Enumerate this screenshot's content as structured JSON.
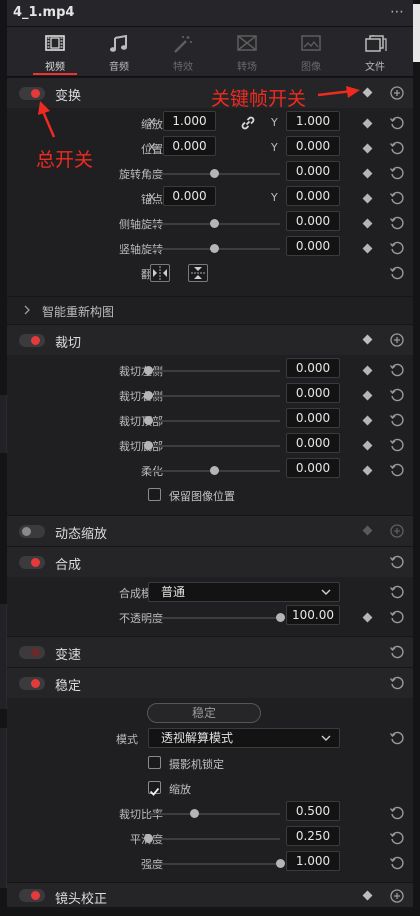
{
  "file": {
    "name": "4_1.mp4",
    "menu_glyph": "⋯"
  },
  "tabs": [
    {
      "label": "视频",
      "icon": "film-icon",
      "active": true,
      "enabled": true
    },
    {
      "label": "音频",
      "icon": "music-note-icon",
      "active": false,
      "enabled": true
    },
    {
      "label": "特效",
      "icon": "magic-wand-icon",
      "active": false,
      "enabled": false
    },
    {
      "label": "转场",
      "icon": "transition-icon",
      "active": false,
      "enabled": false
    },
    {
      "label": "图像",
      "icon": "image-icon",
      "active": false,
      "enabled": false
    },
    {
      "label": "文件",
      "icon": "file-stack-icon",
      "active": false,
      "enabled": true
    }
  ],
  "transform": {
    "title": "变换",
    "zoom": {
      "label": "缩放",
      "x_axis": "X",
      "x": "1.000",
      "y_axis": "Y",
      "y": "1.000"
    },
    "position": {
      "label": "位置",
      "x_axis": "X",
      "x": "0.000",
      "y_axis": "Y",
      "y": "0.000"
    },
    "rotation": {
      "label": "旋转角度",
      "value": "0.000",
      "slider": 0.5
    },
    "anchor": {
      "label": "锚点",
      "x_axis": "X",
      "x": "0.000",
      "y_axis": "Y",
      "y": "0.000"
    },
    "pitch": {
      "label": "侧轴旋转",
      "value": "0.000",
      "slider": 0.5
    },
    "yaw": {
      "label": "竖轴旋转",
      "value": "0.000",
      "slider": 0.5
    },
    "flip": {
      "label": "翻转"
    }
  },
  "smart_reframe": {
    "title": "智能重新构图"
  },
  "cropping": {
    "title": "裁切",
    "left": {
      "label": "裁切左侧",
      "value": "0.000",
      "slider": 0.0
    },
    "right": {
      "label": "裁切右侧",
      "value": "0.000",
      "slider": 0.0
    },
    "top": {
      "label": "裁切顶部",
      "value": "0.000",
      "slider": 0.0
    },
    "bottom": {
      "label": "裁切底部",
      "value": "0.000",
      "slider": 0.0
    },
    "softness": {
      "label": "柔化",
      "value": "0.000",
      "slider": 0.5
    },
    "retain": {
      "label": "保留图像位置",
      "checked": false
    }
  },
  "dynamic_zoom": {
    "title": "动态缩放"
  },
  "composite": {
    "title": "合成",
    "mode": {
      "label": "合成模式",
      "value": "普通"
    },
    "opacity": {
      "label": "不透明度",
      "value": "100.00",
      "slider": 1.0
    }
  },
  "speed_change": {
    "title": "变速"
  },
  "stabilization": {
    "title": "稳定",
    "button": "稳定",
    "mode": {
      "label": "模式",
      "value": "透视解算模式"
    },
    "camera_lock": {
      "label": "摄影机锁定",
      "checked": false
    },
    "zoom": {
      "label": "缩放",
      "checked": true
    },
    "crop_ratio": {
      "label": "裁切比率",
      "value": "0.500",
      "slider": 0.5
    },
    "smooth": {
      "label": "平滑度",
      "value": "0.250",
      "slider": 0.0
    },
    "strength": {
      "label": "强度",
      "value": "1.000",
      "slider": 1.0
    }
  },
  "lens_correction": {
    "title": "镜头校正"
  },
  "annotations": {
    "keyframe_switch": "关键帧开关",
    "master_switch": "总开关"
  },
  "colors": {
    "accent_red": "#e63a3a",
    "annotation_red": "#ee2b20"
  }
}
